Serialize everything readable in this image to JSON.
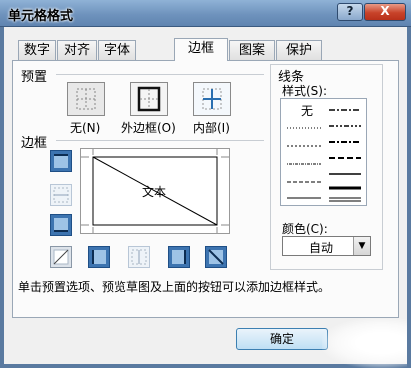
{
  "window": {
    "title": "单元格格式",
    "help_label": "?",
    "close_label": "X"
  },
  "tabs": [
    {
      "label": "数字"
    },
    {
      "label": "对齐"
    },
    {
      "label": "字体"
    },
    {
      "label": "边框",
      "active": true
    },
    {
      "label": "图案"
    },
    {
      "label": "保护"
    }
  ],
  "presets": {
    "section_label": "预置",
    "items": [
      {
        "label": "无(N)"
      },
      {
        "label": "外边框(O)"
      },
      {
        "label": "内部(I)"
      }
    ]
  },
  "border": {
    "section_label": "边框",
    "preview_text": "文本"
  },
  "line": {
    "section_label": "线条",
    "style_label": "样式(S):",
    "none_label": "无",
    "color_label": "颜色(C):",
    "color_value": "自动"
  },
  "info_text": "单击预置选项、预览草图及上面的按钮可以添加边框样式。",
  "buttons": {
    "ok_label": "确定"
  },
  "colors": {
    "accent": "#3c7fb1",
    "titlebar": "#7a9cc6",
    "close": "#c8432a"
  }
}
